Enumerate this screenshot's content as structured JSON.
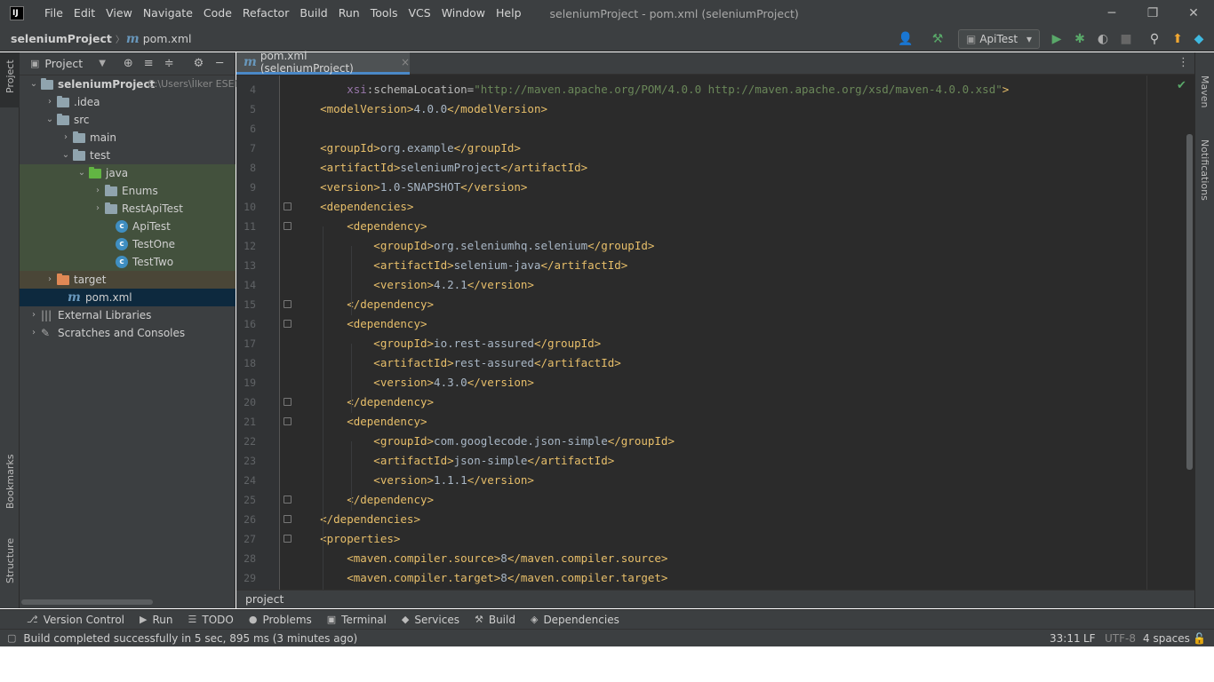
{
  "app": {
    "logo": "IJ",
    "window_title": "seleniumProject - pom.xml (seleniumProject)"
  },
  "menu": [
    "File",
    "Edit",
    "View",
    "Navigate",
    "Code",
    "Refactor",
    "Build",
    "Run",
    "Tools",
    "VCS",
    "Window",
    "Help"
  ],
  "window_controls": {
    "minimize": "─",
    "maximize": "❐",
    "close": "✕"
  },
  "breadcrumb": {
    "project": "seleniumProject",
    "sep": "〉",
    "file_icon": "m",
    "file": "pom.xml"
  },
  "run_config": {
    "name": "ApiTest",
    "arrow": "▾"
  },
  "left_strip": {
    "project": "Project",
    "bookmarks": "Bookmarks",
    "structure": "Structure"
  },
  "right_strip": {
    "maven": "Maven",
    "notifications": "Notifications"
  },
  "project_panel": {
    "title": "Project",
    "tree": [
      {
        "label": "seleniumProject",
        "hint": "C:\\Users\\İlker ESEN\\",
        "type": "module",
        "arrow": "⌄",
        "bold": true
      },
      {
        "label": ".idea",
        "type": "folder",
        "arrow": "›"
      },
      {
        "label": "src",
        "type": "folder",
        "arrow": "⌄"
      },
      {
        "label": "main",
        "type": "folder",
        "arrow": "›"
      },
      {
        "label": "test",
        "type": "folder",
        "arrow": "⌄"
      },
      {
        "label": "java",
        "type": "green-folder",
        "arrow": "⌄"
      },
      {
        "label": "Enums",
        "type": "package",
        "arrow": "›"
      },
      {
        "label": "RestApiTest",
        "type": "package",
        "arrow": "›"
      },
      {
        "label": "ApiTest",
        "type": "class",
        "arrow": ""
      },
      {
        "label": "TestOne",
        "type": "class",
        "arrow": ""
      },
      {
        "label": "TestTwo",
        "type": "class",
        "arrow": ""
      },
      {
        "label": "target",
        "type": "orange-folder",
        "arrow": "›"
      },
      {
        "label": "pom.xml",
        "type": "maven",
        "arrow": ""
      },
      {
        "label": "External Libraries",
        "type": "library",
        "arrow": "›"
      },
      {
        "label": "Scratches and Consoles",
        "type": "scratch",
        "arrow": "›"
      }
    ]
  },
  "editor": {
    "tab": {
      "icon": "m",
      "label": "pom.xml (seleniumProject)",
      "close": "×"
    },
    "lines": [
      {
        "n": "4",
        "segs": [
          [
            "xs",
            "        xsi"
          ],
          [
            "attr",
            ":schemaLocation="
          ],
          [
            "str",
            "\"http://maven.apache.org/POM/4.0.0 http://maven.apache.org/xsd/maven-4.0.0.xsd\""
          ],
          [
            "tag",
            ">"
          ]
        ]
      },
      {
        "n": "5",
        "segs": [
          [
            "tag",
            "    <modelVersion>"
          ],
          [
            "txt",
            "4.0.0"
          ],
          [
            "tag",
            "</modelVersion>"
          ]
        ]
      },
      {
        "n": "6",
        "segs": []
      },
      {
        "n": "7",
        "segs": [
          [
            "tag",
            "    <groupId>"
          ],
          [
            "txt",
            "org.example"
          ],
          [
            "tag",
            "</groupId>"
          ]
        ]
      },
      {
        "n": "8",
        "segs": [
          [
            "tag",
            "    <artifactId>"
          ],
          [
            "txt",
            "seleniumProject"
          ],
          [
            "tag",
            "</artifactId>"
          ]
        ]
      },
      {
        "n": "9",
        "segs": [
          [
            "tag",
            "    <version>"
          ],
          [
            "txt",
            "1.0-SNAPSHOT"
          ],
          [
            "tag",
            "</version>"
          ]
        ]
      },
      {
        "n": "10",
        "segs": [
          [
            "tag",
            "    <dependencies>"
          ]
        ]
      },
      {
        "n": "11",
        "segs": [
          [
            "tag",
            "        <dependency>"
          ]
        ]
      },
      {
        "n": "12",
        "segs": [
          [
            "tag",
            "            <groupId>"
          ],
          [
            "txt",
            "org.seleniumhq.selenium"
          ],
          [
            "tag",
            "</groupId>"
          ]
        ]
      },
      {
        "n": "13",
        "segs": [
          [
            "tag",
            "            <artifactId>"
          ],
          [
            "txt",
            "selenium-java"
          ],
          [
            "tag",
            "</artifactId>"
          ]
        ]
      },
      {
        "n": "14",
        "segs": [
          [
            "tag",
            "            <version>"
          ],
          [
            "txt",
            "4.2.1"
          ],
          [
            "tag",
            "</version>"
          ]
        ]
      },
      {
        "n": "15",
        "segs": [
          [
            "tag",
            "        </dependency>"
          ]
        ]
      },
      {
        "n": "16",
        "segs": [
          [
            "tag",
            "        <dependency>"
          ]
        ]
      },
      {
        "n": "17",
        "segs": [
          [
            "tag",
            "            <groupId>"
          ],
          [
            "txt",
            "io.rest-assured"
          ],
          [
            "tag",
            "</groupId>"
          ]
        ]
      },
      {
        "n": "18",
        "segs": [
          [
            "tag",
            "            <artifactId>"
          ],
          [
            "txt",
            "rest-assured"
          ],
          [
            "tag",
            "</artifactId>"
          ]
        ]
      },
      {
        "n": "19",
        "segs": [
          [
            "tag",
            "            <version>"
          ],
          [
            "txt",
            "4.3.0"
          ],
          [
            "tag",
            "</version>"
          ]
        ]
      },
      {
        "n": "20",
        "segs": [
          [
            "tag",
            "        </dependency>"
          ]
        ]
      },
      {
        "n": "21",
        "segs": [
          [
            "tag",
            "        <dependency>"
          ]
        ]
      },
      {
        "n": "22",
        "segs": [
          [
            "tag",
            "            <groupId>"
          ],
          [
            "txt",
            "com.googlecode.json-simple"
          ],
          [
            "tag",
            "</groupId>"
          ]
        ]
      },
      {
        "n": "23",
        "segs": [
          [
            "tag",
            "            <artifactId>"
          ],
          [
            "txt",
            "json-simple"
          ],
          [
            "tag",
            "</artifactId>"
          ]
        ]
      },
      {
        "n": "24",
        "segs": [
          [
            "tag",
            "            <version>"
          ],
          [
            "txt",
            "1.1.1"
          ],
          [
            "tag",
            "</version>"
          ]
        ]
      },
      {
        "n": "25",
        "segs": [
          [
            "tag",
            "        </dependency>"
          ]
        ]
      },
      {
        "n": "26",
        "segs": [
          [
            "tag",
            "    </dependencies>"
          ]
        ]
      },
      {
        "n": "27",
        "segs": [
          [
            "tag",
            "    <properties>"
          ]
        ]
      },
      {
        "n": "28",
        "segs": [
          [
            "tag",
            "        <maven.compiler.source>"
          ],
          [
            "txt",
            "8"
          ],
          [
            "tag",
            "</maven.compiler.source>"
          ]
        ]
      },
      {
        "n": "29",
        "segs": [
          [
            "tag",
            "        <maven.compiler.target>"
          ],
          [
            "txt",
            "8"
          ],
          [
            "tag",
            "</maven.compiler.target>"
          ]
        ]
      }
    ],
    "breadcrumb": "project"
  },
  "bottom_tools": [
    {
      "icon": "⎇",
      "label": "Version Control"
    },
    {
      "icon": "▶",
      "label": "Run"
    },
    {
      "icon": "☰",
      "label": "TODO"
    },
    {
      "icon": "●",
      "label": "Problems"
    },
    {
      "icon": "▣",
      "label": "Terminal"
    },
    {
      "icon": "◆",
      "label": "Services"
    },
    {
      "icon": "⚒",
      "label": "Build"
    },
    {
      "icon": "◈",
      "label": "Dependencies"
    }
  ],
  "status": {
    "message": "Build completed successfully in 5 sec, 895 ms (3 minutes ago)",
    "position": "33:11",
    "line_ending": "LF",
    "encoding": "UTF-8",
    "indent": "4 spaces"
  },
  "colors": {
    "accent": "#4a88c7",
    "tag": "#e8bf6a",
    "string": "#6a8759",
    "green_check": "#59a869"
  }
}
